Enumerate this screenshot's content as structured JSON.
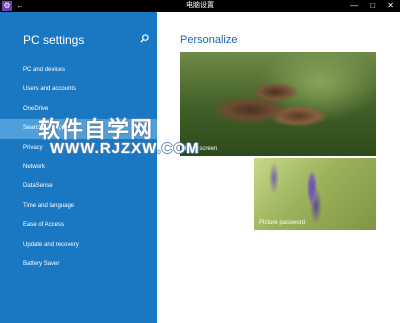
{
  "window": {
    "title": "电脑设置",
    "app_icon": "settings-gear-icon",
    "back": "←",
    "controls": [
      "—",
      "□",
      "✕"
    ]
  },
  "sidebar": {
    "title": "PC settings",
    "search_icon": "search-icon",
    "items": [
      {
        "label": "PC and devices"
      },
      {
        "label": "Users and accounts"
      },
      {
        "label": "OneDrive"
      },
      {
        "label": "Search and apps",
        "selected": true
      },
      {
        "label": "Privacy"
      },
      {
        "label": "Network"
      },
      {
        "label": "DataSense"
      },
      {
        "label": "Time and language"
      },
      {
        "label": "Ease of Access"
      },
      {
        "label": "Update and recovery"
      },
      {
        "label": "Battery Saver"
      }
    ]
  },
  "main": {
    "title": "Personalize",
    "tiles": {
      "lock_screen": "Lock screen",
      "picture_password": "Picture password"
    }
  },
  "watermark": {
    "main": "软件自学网",
    "sub": "WWW.RJZXW.COM"
  },
  "colors": {
    "sidebar": "#1a78c2",
    "sidebar_selected": "#4e9fdb",
    "accent": "#1e63b5",
    "titlebar": "#000000"
  }
}
